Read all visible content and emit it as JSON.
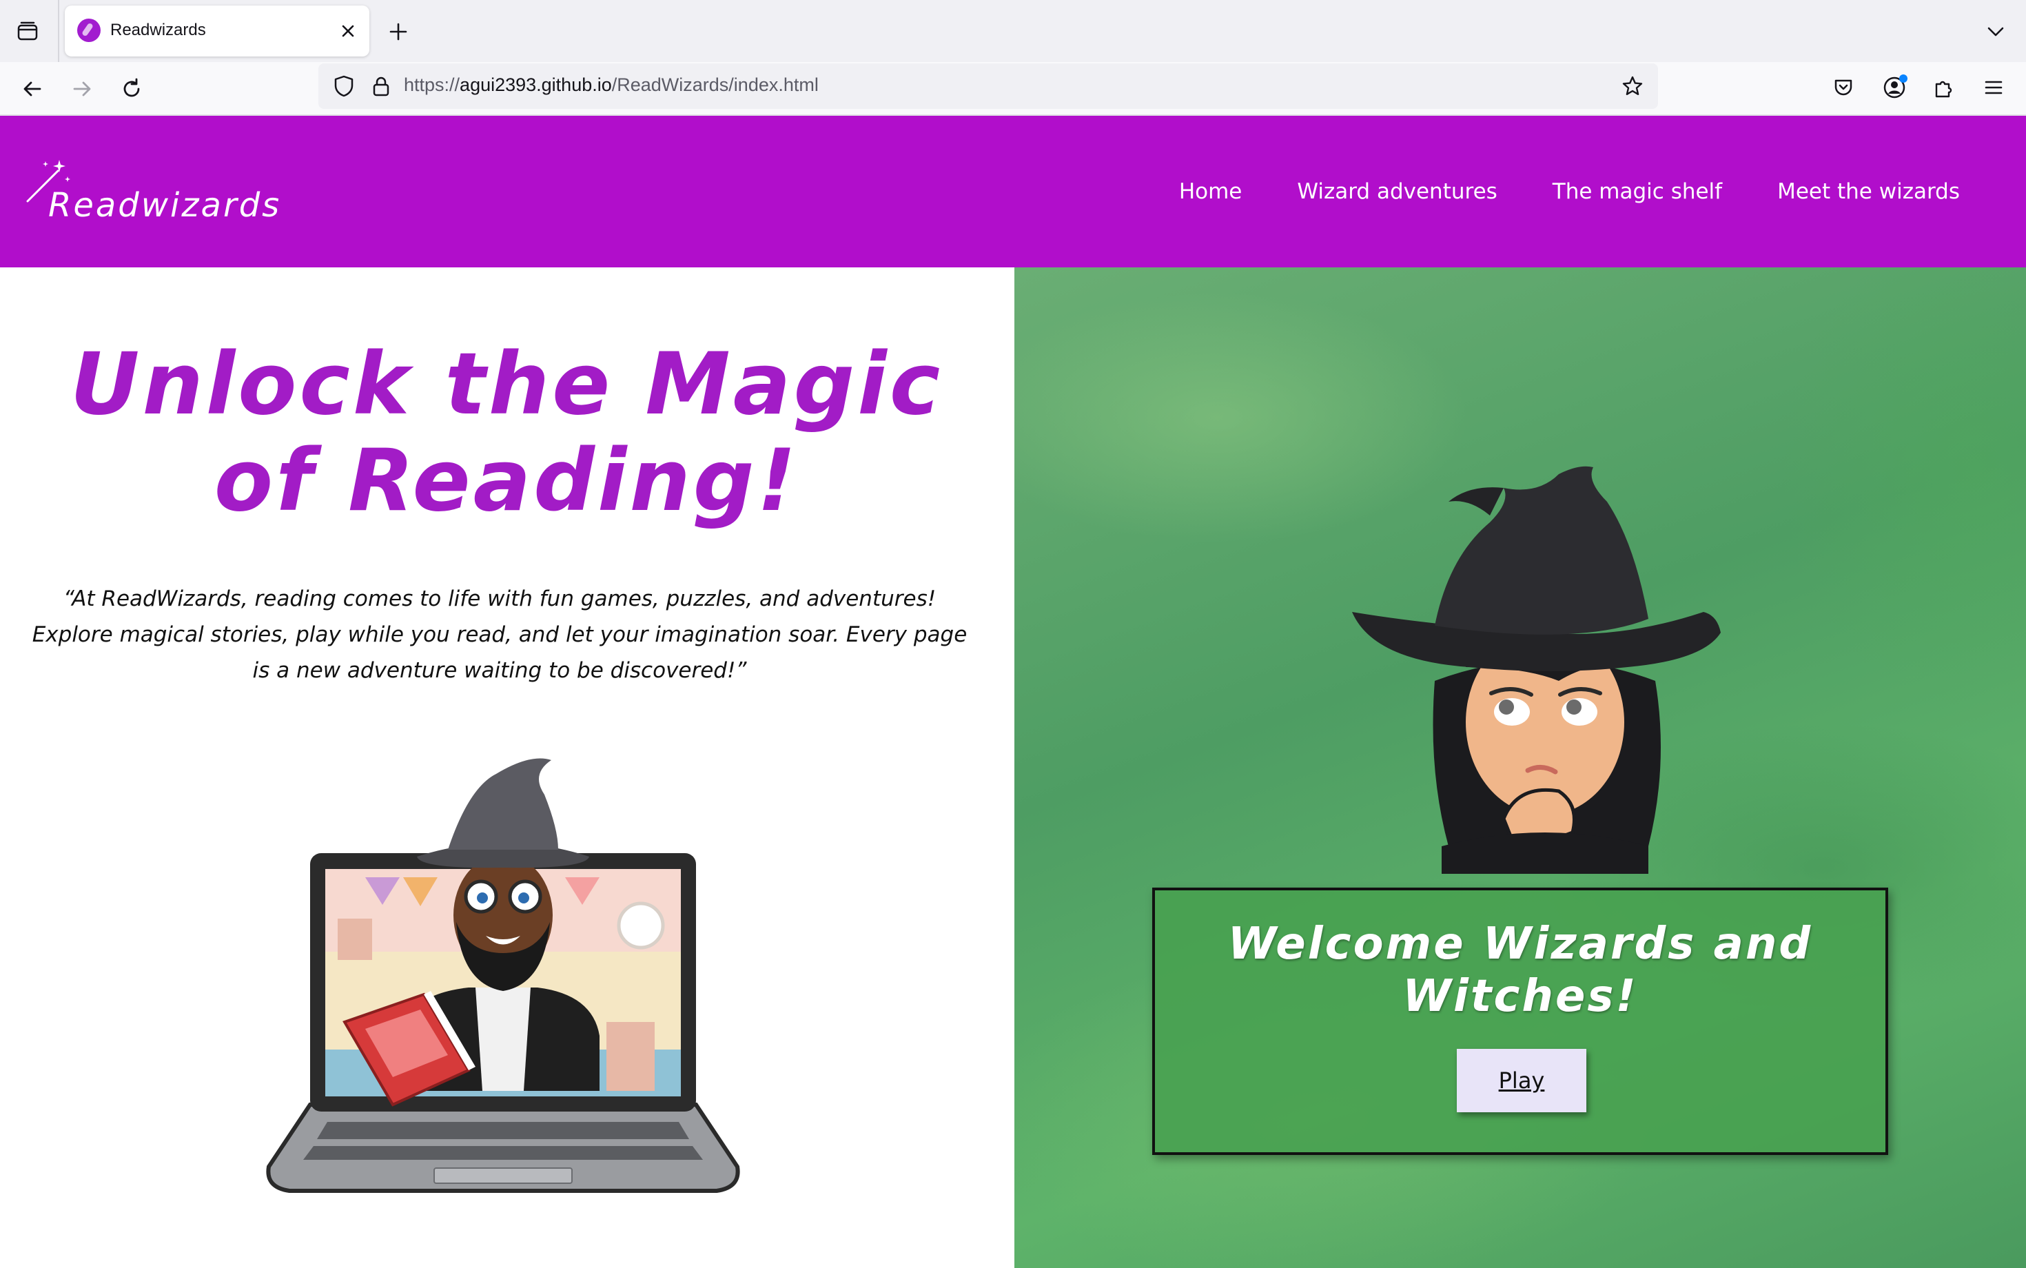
{
  "browser": {
    "tab": {
      "title": "Readwizards",
      "favicon": "readwizards-favicon"
    },
    "url": {
      "scheme": "https://",
      "host": "agui2393.github.io",
      "path": "/ReadWizards/index.html"
    },
    "icons": {
      "tab_list": "tab-list-icon",
      "close": "close-icon",
      "new_tab": "plus-icon",
      "tabs_menu": "chevron-down-icon",
      "back": "back-arrow-icon",
      "forward": "forward-arrow-icon",
      "reload": "reload-icon",
      "shield": "shield-icon",
      "lock": "lock-icon",
      "bookmark": "star-icon",
      "pocket": "pocket-icon",
      "account": "account-icon",
      "extensions": "puzzle-icon",
      "menu": "hamburger-menu-icon"
    }
  },
  "site": {
    "brand": "Readwizards",
    "nav": [
      "Home",
      "Wizard adventures",
      "The magic shelf",
      "Meet the wizards"
    ],
    "colors": {
      "header": "#b10ecb",
      "title": "#a21cc6",
      "play_button": "#e8e4f8"
    }
  },
  "hero": {
    "title": "Unlock the Magic of Reading!",
    "quote": "“At ReadWizards, reading comes to life with fun games, puzzles, and adventures! Explore magical stories, play while you read, and let your imagination soar. Every page is a new adventure waiting to be discovered!”"
  },
  "welcome": {
    "title": "Welcome Wizards and Witches!",
    "play_label": "Play"
  }
}
